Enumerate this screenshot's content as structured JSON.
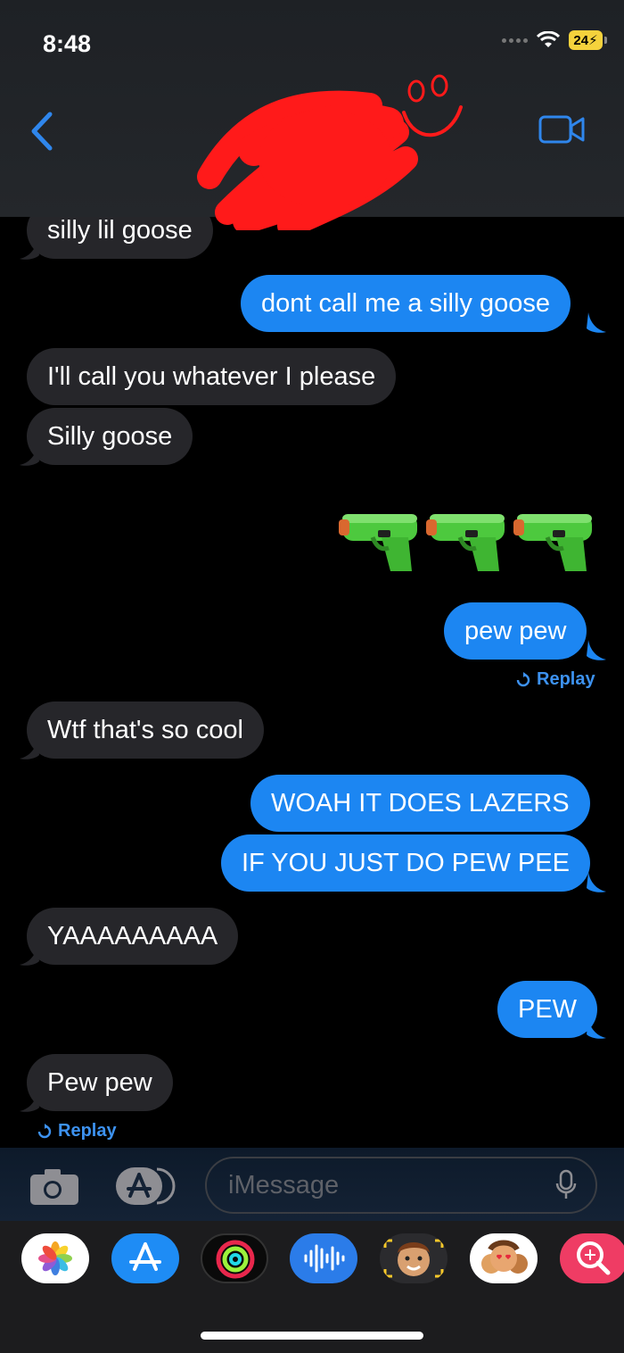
{
  "status_bar": {
    "time": "8:48",
    "battery": "24"
  },
  "header": {
    "back_icon": "chevron-left-icon",
    "video_icon": "video-camera-icon",
    "contact_redacted": true
  },
  "messages": [
    {
      "from": "them",
      "text": "silly lil goose"
    },
    {
      "from": "me",
      "text": "dont call me a silly goose"
    },
    {
      "from": "them",
      "text": "I'll call you whatever I please"
    },
    {
      "from": "them",
      "text": "Silly goose"
    },
    {
      "from": "me",
      "text": "🔫🔫🔫",
      "kind": "emoji"
    },
    {
      "from": "me",
      "text": "pew pew"
    },
    {
      "from": "them",
      "text": "Wtf that's so cool"
    },
    {
      "from": "me",
      "text": "WOAH IT DOES LAZERS"
    },
    {
      "from": "me",
      "text": "IF YOU JUST DO PEW PEE"
    },
    {
      "from": "them",
      "text": "YAAAAAAAAA"
    },
    {
      "from": "me",
      "text": "PEW"
    },
    {
      "from": "them",
      "text": "Pew pew"
    }
  ],
  "replay_label": "Replay",
  "input": {
    "placeholder": "iMessage"
  },
  "apps": [
    {
      "name": "photos-app-icon"
    },
    {
      "name": "app-store-icon"
    },
    {
      "name": "activity-icon"
    },
    {
      "name": "audio-message-icon"
    },
    {
      "name": "memoji-icon"
    },
    {
      "name": "memoji-stickers-icon"
    },
    {
      "name": "image-search-icon"
    }
  ],
  "colors": {
    "outgoing": "#1c86f2",
    "incoming": "#26262a",
    "accent": "#3d92f0"
  }
}
